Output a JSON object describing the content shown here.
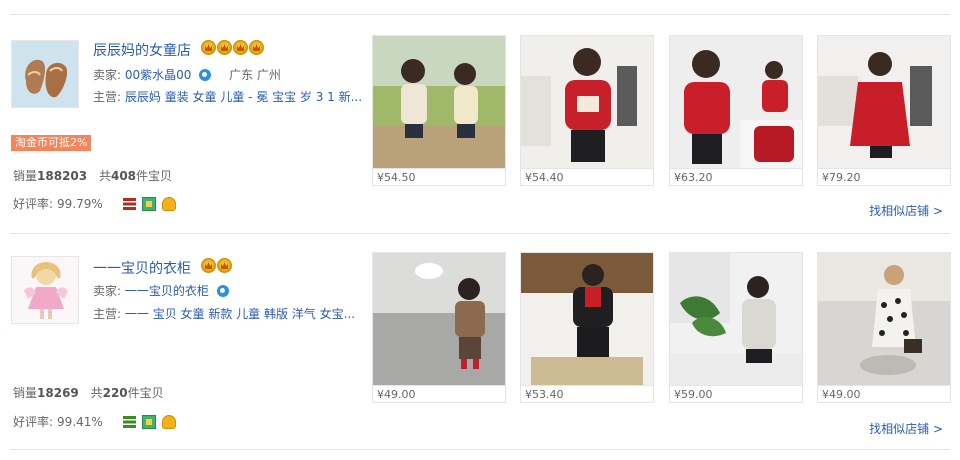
{
  "shops": [
    {
      "name": "辰辰妈的女童店",
      "crown_count": 4,
      "seller_label": "卖家:",
      "seller": "00紫水晶00",
      "location": "广东 广州",
      "main_label": "主营:",
      "main_items": "辰辰妈 童装 女童 儿童 - 冕 宝宝 岁 3 1 新...",
      "discount": "淘金币可抵2%",
      "sales_label": "销量",
      "sales": "188203",
      "total_prefix": "共",
      "total_count": "408",
      "total_suffix": "件宝贝",
      "rating_label": "好评率:",
      "rating": "99.79%",
      "similar": "找相似店铺 >",
      "products": [
        {
          "price": "¥54.50"
        },
        {
          "price": "¥54.40"
        },
        {
          "price": "¥63.20"
        },
        {
          "price": "¥79.20"
        }
      ]
    },
    {
      "name": "一一宝贝的衣柜",
      "crown_count": 2,
      "seller_label": "卖家:",
      "seller": "一一宝贝的衣柜",
      "location": "",
      "main_label": "主营:",
      "main_items": "一一 宝贝 女童 新款 儿童 韩版 洋气 女宝...",
      "discount": "",
      "sales_label": "销量",
      "sales": "18269",
      "total_prefix": "共",
      "total_count": "220",
      "total_suffix": "件宝贝",
      "rating_label": "好评率:",
      "rating": "99.41%",
      "similar": "找相似店铺 >",
      "products": [
        {
          "price": "¥49.00"
        },
        {
          "price": "¥53.40"
        },
        {
          "price": "¥59.00"
        },
        {
          "price": "¥49.00"
        }
      ]
    }
  ]
}
